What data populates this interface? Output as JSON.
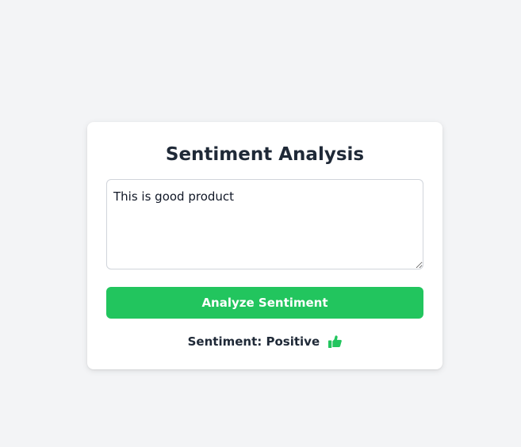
{
  "app": {
    "title": "Sentiment Analysis"
  },
  "input": {
    "value": "This is good product",
    "placeholder": ""
  },
  "actions": {
    "analyze_label": "Analyze Sentiment"
  },
  "result": {
    "prefix": "Sentiment:",
    "value": "Positive",
    "icon": "thumbs-up-icon"
  },
  "colors": {
    "accent": "#22c55e",
    "background": "#f3f4f6",
    "card": "#ffffff",
    "text": "#1f2937"
  }
}
